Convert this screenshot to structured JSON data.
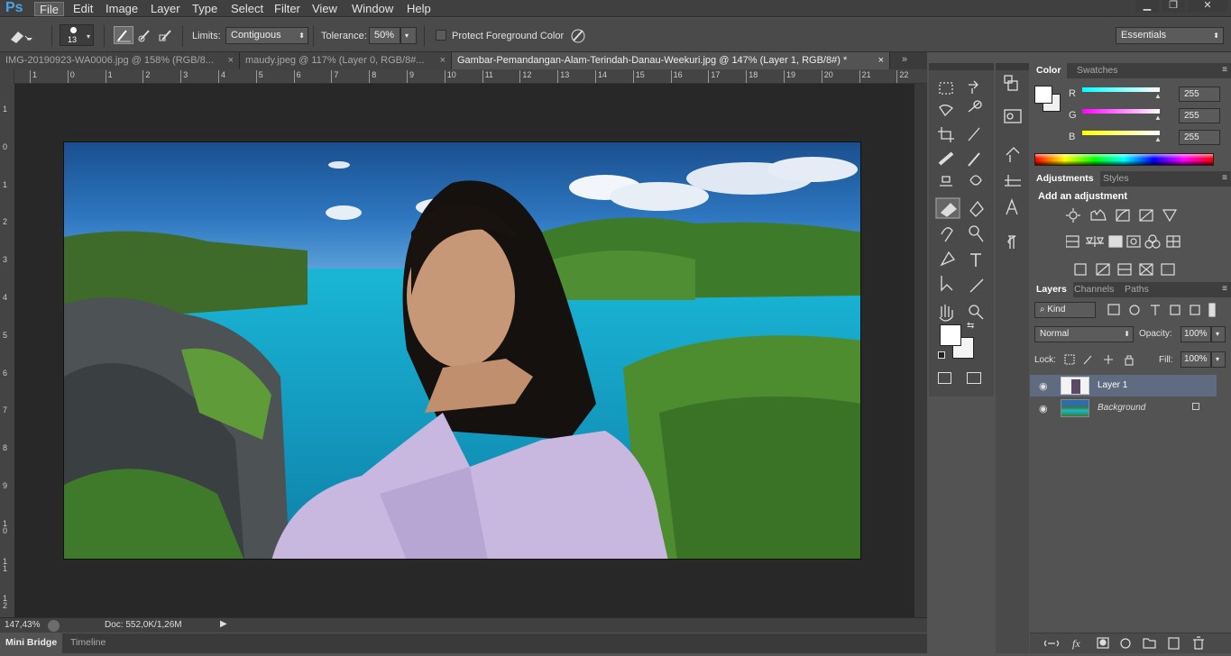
{
  "app": {
    "logo": "Ps"
  },
  "menu": [
    "File",
    "Edit",
    "Image",
    "Layer",
    "Type",
    "Select",
    "Filter",
    "View",
    "Window",
    "Help"
  ],
  "window_controls": {
    "minimize": "▁",
    "restore": "❐",
    "close": "✕"
  },
  "options": {
    "brush_size": "13",
    "limits_label": "Limits:",
    "limits_value": "Contiguous",
    "tolerance_label": "Tolerance:",
    "tolerance_value": "50%",
    "protect_label": "Protect Foreground Color",
    "workspace": "Essentials"
  },
  "tabs": [
    {
      "label": "IMG-20190923-WA0006.jpg @ 158% (RGB/8..."
    },
    {
      "label": "maudy.jpeg @ 117% (Layer 0, RGB/8#..."
    },
    {
      "label": "Gambar-Pemandangan-Alam-Terindah-Danau-Weekuri.jpg @ 147% (Layer 1, RGB/8#) *"
    }
  ],
  "ruler_h": [
    "1",
    "0",
    "1",
    "2",
    "3",
    "4",
    "5",
    "6",
    "7",
    "8",
    "9",
    "10",
    "11",
    "12",
    "13",
    "14",
    "15",
    "16",
    "17",
    "18",
    "19",
    "20",
    "21",
    "22"
  ],
  "ruler_v": [
    "1",
    "0",
    "1",
    "2",
    "3",
    "4",
    "5",
    "6",
    "7",
    "8",
    "9",
    "1 0",
    "1 1",
    "1 2"
  ],
  "status": {
    "zoom": "147,43%",
    "doc": "Doc: 552,0K/1,26M"
  },
  "bottom_tabs": [
    "Mini Bridge",
    "Timeline"
  ],
  "color_panel": {
    "tabs": [
      "Color",
      "Swatches"
    ],
    "r_label": "R",
    "g_label": "G",
    "b_label": "B",
    "r": "255",
    "g": "255",
    "b": "255"
  },
  "adjustments_panel": {
    "tabs": [
      "Adjustments",
      "Styles"
    ],
    "title": "Add an adjustment"
  },
  "layers_panel": {
    "tabs": [
      "Layers",
      "Channels",
      "Paths"
    ],
    "kind": "Kind",
    "blend_mode": "Normal",
    "opacity_label": "Opacity:",
    "opacity": "100%",
    "lock_label": "Lock:",
    "fill_label": "Fill:",
    "fill": "100%",
    "layers": [
      {
        "name": "Layer 1"
      },
      {
        "name": "Background"
      }
    ]
  },
  "colors": {
    "accent": "#4aa3e8",
    "selected_layer": "#5e6b80"
  }
}
